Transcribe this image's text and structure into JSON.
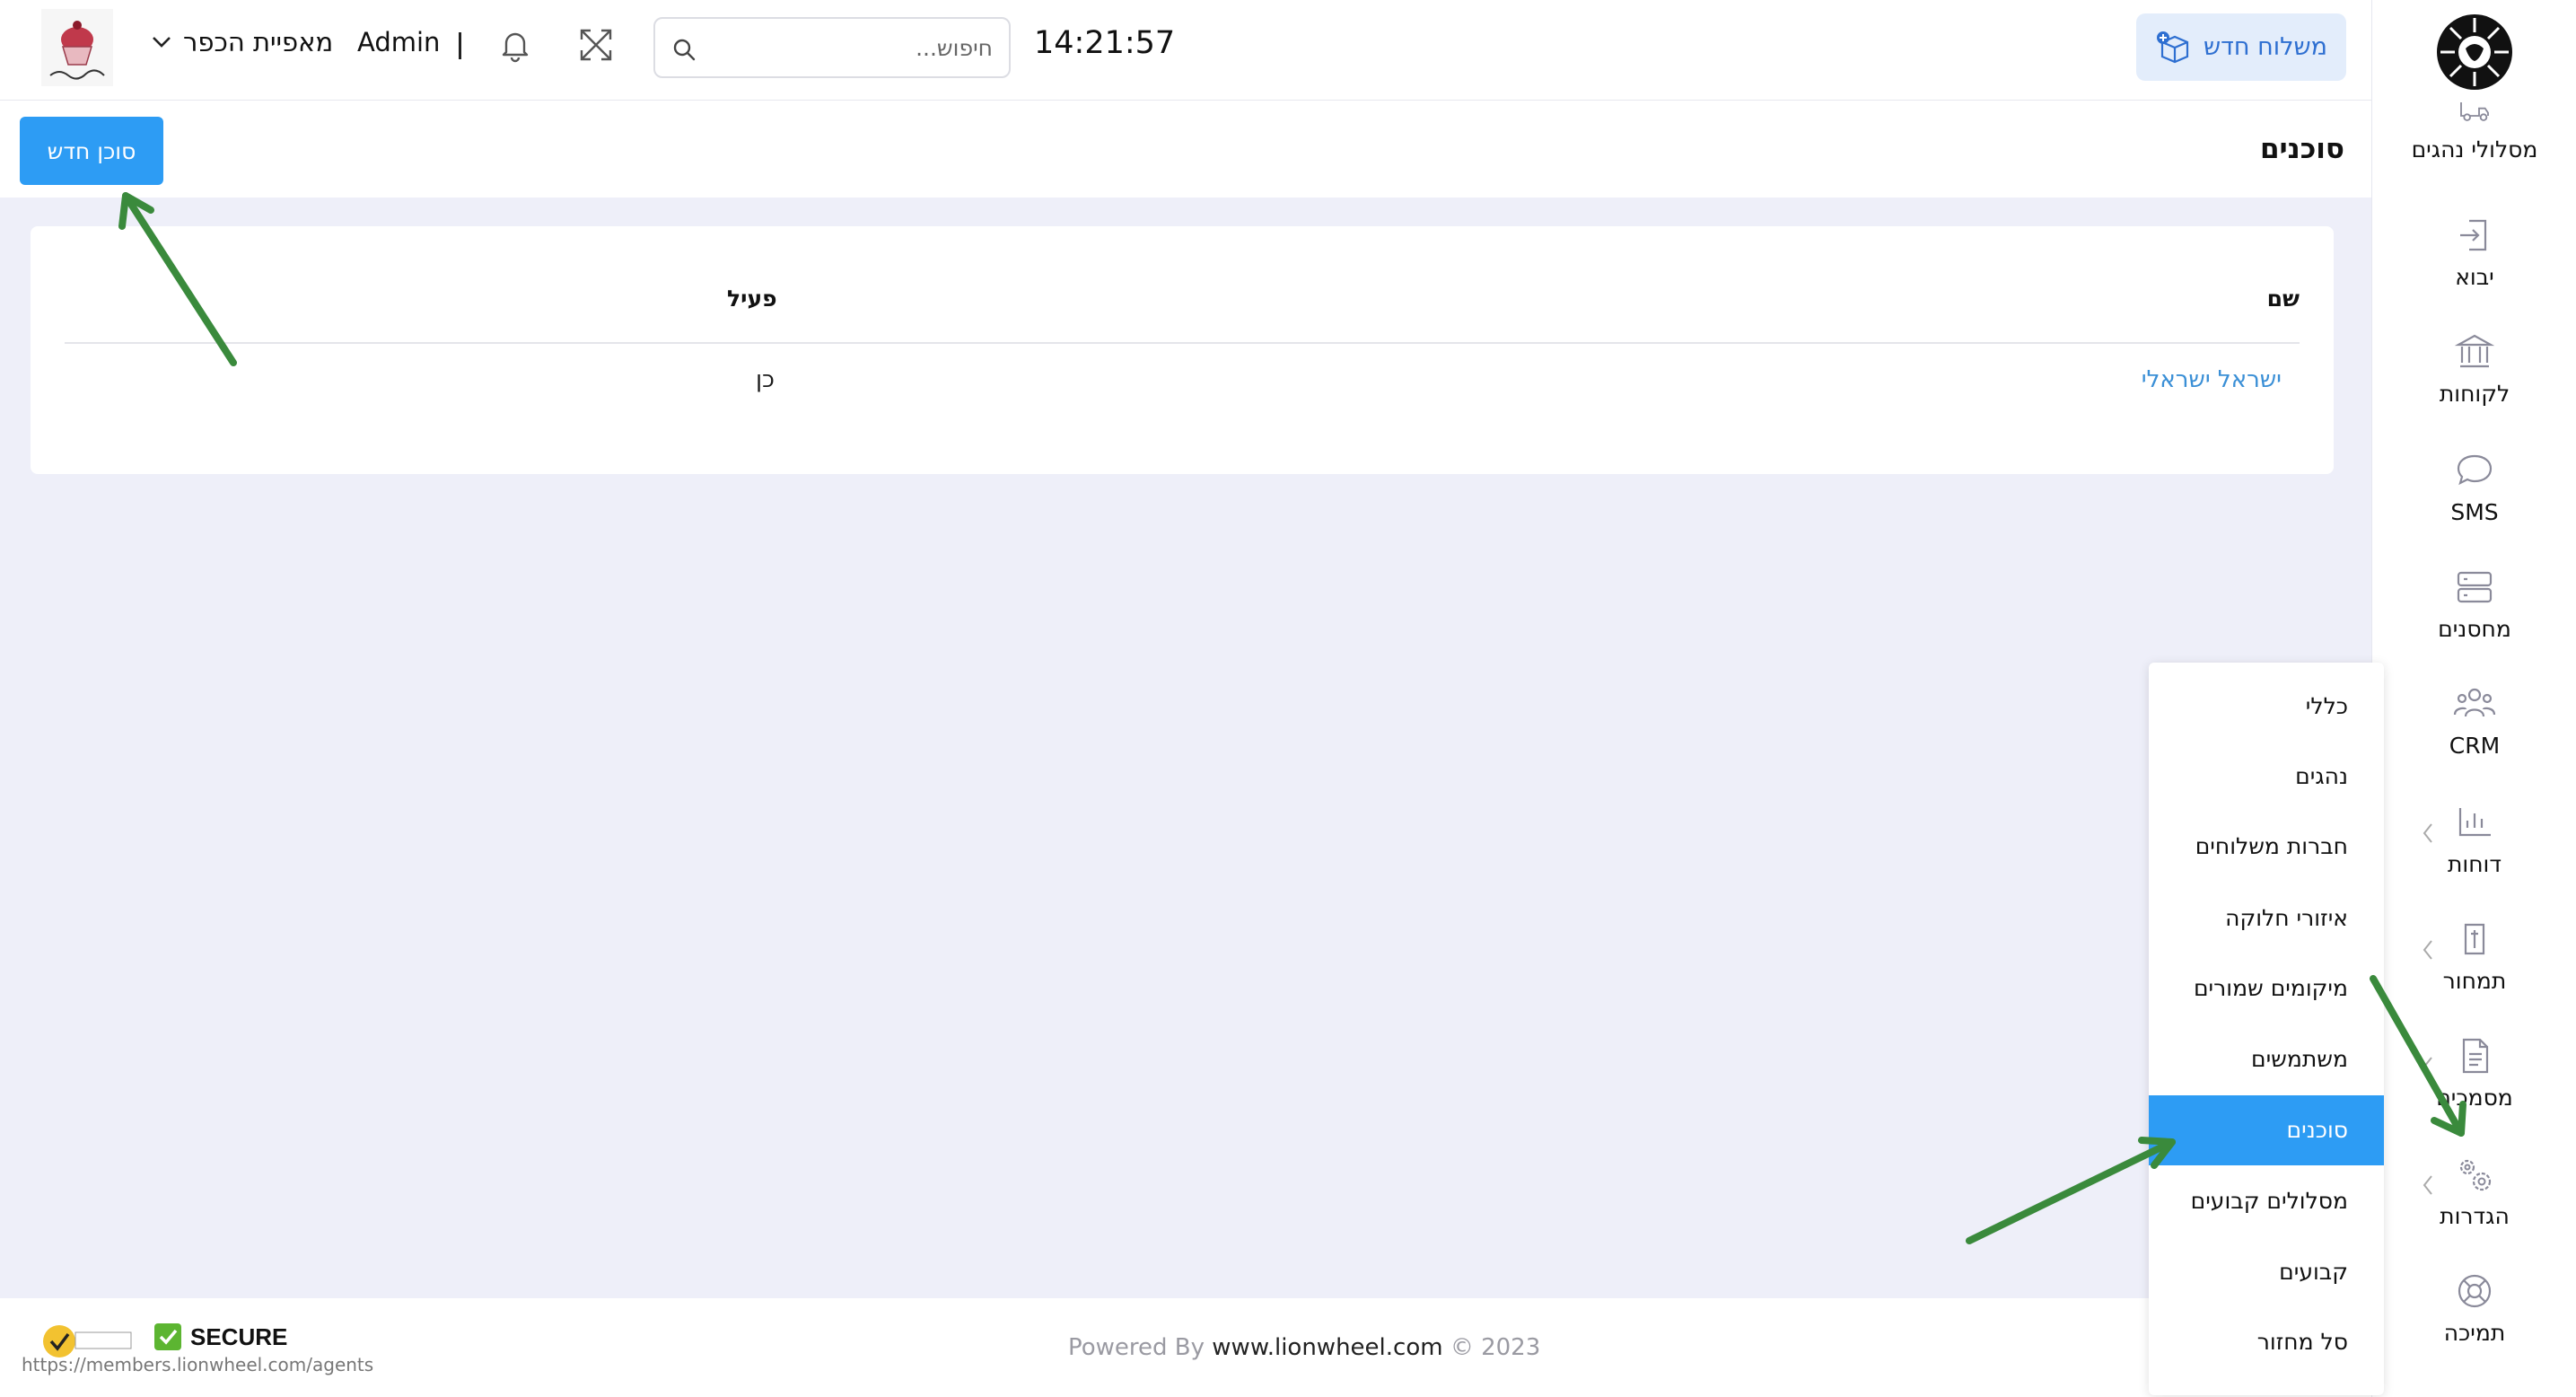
{
  "header": {
    "new_shipment_label": "משלוח חדש",
    "clock": "14:21:57",
    "search_placeholder": "חיפוש...",
    "user": "Admin",
    "separator": "|",
    "company": "מאפיית הכפר",
    "brand_logo": "cupcake-logo"
  },
  "page": {
    "title": "סוכנים",
    "new_agent_label": "סוכן חדש"
  },
  "table": {
    "columns": [
      "שם",
      "פעיל"
    ],
    "rows": [
      {
        "name": "ישראל ישראלי",
        "active": "כן"
      }
    ]
  },
  "sidebar": {
    "items": [
      {
        "label": "מסלולי נהגים",
        "icon": "truck-icon",
        "submenu": false
      },
      {
        "label": "יבוא",
        "icon": "import-icon",
        "submenu": false
      },
      {
        "label": "לקוחות",
        "icon": "bank-icon",
        "submenu": false
      },
      {
        "label": "SMS",
        "icon": "chat-icon",
        "submenu": false
      },
      {
        "label": "מחסנים",
        "icon": "server-icon",
        "submenu": false
      },
      {
        "label": "CRM",
        "icon": "users-icon",
        "submenu": false
      },
      {
        "label": "דוחות",
        "icon": "report-icon",
        "submenu": true
      },
      {
        "label": "תמחור",
        "icon": "pricing-icon",
        "submenu": true
      },
      {
        "label": "מסמכים",
        "icon": "document-icon",
        "submenu": true
      },
      {
        "label": "הגדרות",
        "icon": "settings-icon",
        "submenu": true
      },
      {
        "label": "תמיכה",
        "icon": "lifebuoy-icon",
        "submenu": false
      }
    ]
  },
  "settings_menu": {
    "items": [
      {
        "label": "כללי",
        "active": false
      },
      {
        "label": "נהגים",
        "active": false
      },
      {
        "label": "חברות משלוחים",
        "active": false
      },
      {
        "label": "איזורי חלוקה",
        "active": false
      },
      {
        "label": "מיקומים שמורים",
        "active": false
      },
      {
        "label": "משתמשים",
        "active": false
      },
      {
        "label": "סוכנים",
        "active": true
      },
      {
        "label": "מסלולים קבועים",
        "active": false
      },
      {
        "label": "קבועים",
        "active": false
      },
      {
        "label": "סל מחזור",
        "active": false
      }
    ]
  },
  "footer": {
    "powered_prefix": "Powered By",
    "site": "www.lionwheel.com",
    "copyright": "© 2023",
    "secure_label": "SECURE",
    "url": "https://members.lionwheel.com/agents"
  },
  "colors": {
    "primary": "#2d9cf4",
    "link": "#3a8fd6",
    "page_bg": "#eeeff9",
    "annotation_arrow": "#3a8a3c"
  }
}
